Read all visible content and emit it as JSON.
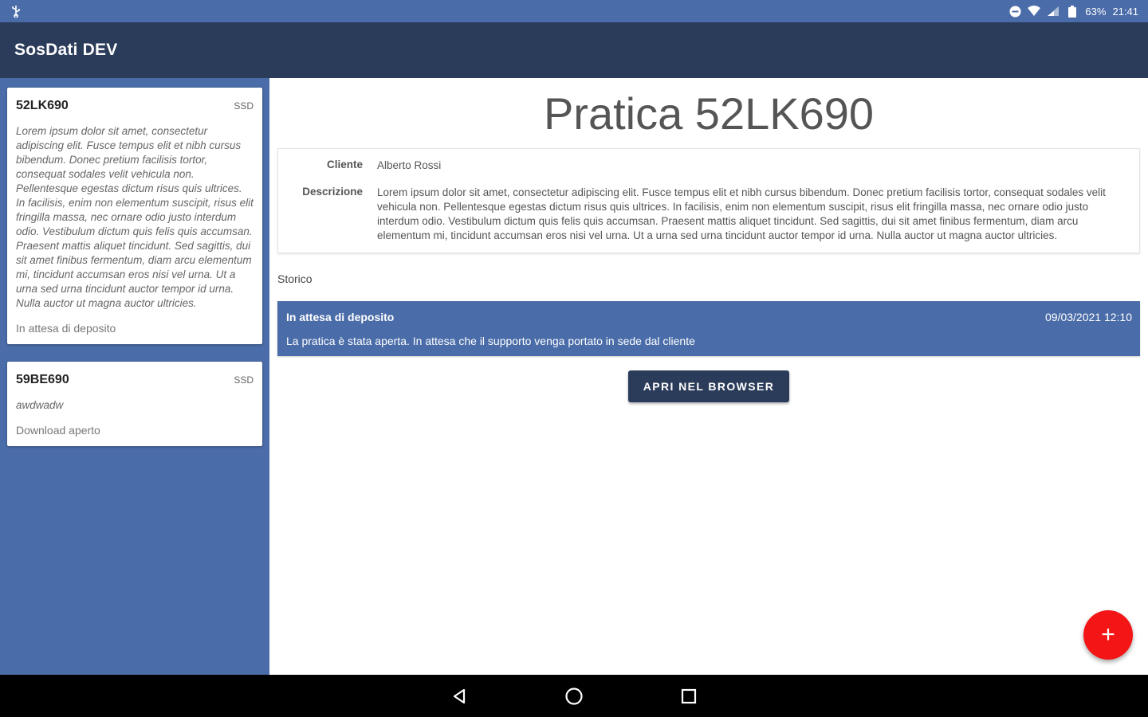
{
  "status_bar": {
    "usb_icon": "usb-icon",
    "battery": "63%",
    "time": "21:41"
  },
  "app_bar": {
    "title": "SosDati DEV"
  },
  "sidebar": {
    "cards": [
      {
        "code": "52LK690",
        "tag": "SSD",
        "description": "Lorem ipsum dolor sit amet, consectetur adipiscing elit. Fusce tempus elit et nibh cursus bibendum. Donec pretium facilisis tortor, consequat sodales velit vehicula non. Pellentesque egestas dictum risus quis ultrices. In facilisis, enim non elementum suscipit, risus elit fringilla massa, nec ornare odio justo interdum odio. Vestibulum dictum quis felis quis accumsan. Praesent mattis aliquet tincidunt. Sed sagittis, dui sit amet finibus fermentum, diam arcu elementum mi, tincidunt accumsan eros nisi vel urna. Ut a urna sed urna tincidunt auctor tempor id urna. Nulla auctor ut magna auctor ultricies.",
        "status": "In attesa di deposito"
      },
      {
        "code": "59BE690",
        "tag": "SSD",
        "description": "awdwadw",
        "status": "Download aperto"
      }
    ]
  },
  "main": {
    "title": "Pratica 52LK690",
    "details": {
      "client_label": "Cliente",
      "client_value": "Alberto Rossi",
      "description_label": "Descrizione",
      "description_value": "Lorem ipsum dolor sit amet, consectetur adipiscing elit. Fusce tempus elit et nibh cursus bibendum. Donec pretium facilisis tortor, consequat sodales velit vehicula non. Pellentesque egestas dictum risus quis ultrices. In facilisis, enim non elementum suscipit, risus elit fringilla massa, nec ornare odio justo interdum odio. Vestibulum dictum quis felis quis accumsan. Praesent mattis aliquet tincidunt. Sed sagittis, dui sit amet finibus fermentum, diam arcu elementum mi, tincidunt accumsan eros nisi vel urna. Ut a urna sed urna tincidunt auctor tempor id urna. Nulla auctor ut magna auctor ultricies."
    },
    "history_label": "Storico",
    "history": [
      {
        "title": "In attesa di deposito",
        "date": "09/03/2021 12:10",
        "text": "La pratica è stata aperta. In attesa che il supporto venga portato in sede dal cliente"
      }
    ],
    "open_browser_label": "APRI NEL BROWSER",
    "fab_label": "+"
  },
  "colors": {
    "primary": "#4a6ca8",
    "dark": "#2b3b5a",
    "fab": "#f41616"
  }
}
